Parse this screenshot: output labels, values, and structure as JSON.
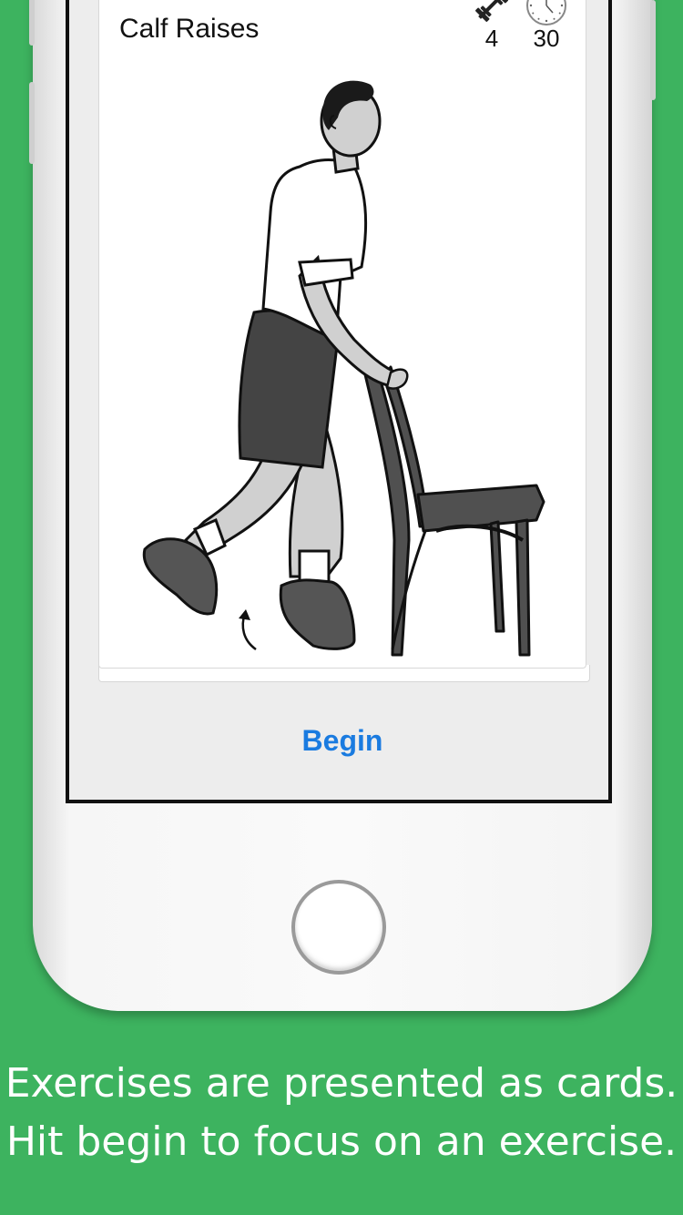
{
  "card": {
    "title": "Calf Raises",
    "weight_icon": "dumbbell-icon",
    "weight_value": "4",
    "timer_icon": "clock-icon",
    "timer_value": "30"
  },
  "actions": {
    "begin_label": "Begin"
  },
  "caption": {
    "line1": "Exercises are presented as cards.",
    "line2": "Hit begin to focus on an exercise."
  },
  "colors": {
    "background": "#3db35f",
    "accent": "#1a7be0"
  }
}
